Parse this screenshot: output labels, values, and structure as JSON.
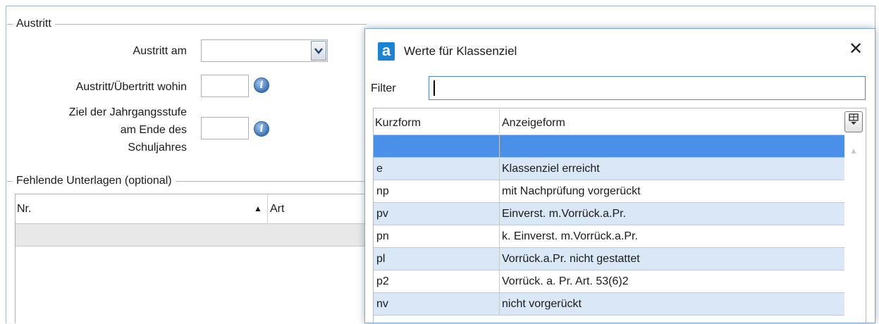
{
  "form": {
    "austritt_group_title": "Austritt",
    "austritt_am_label": "Austritt am",
    "austritt_am_value": "",
    "wohin_label": "Austritt/Übertritt wohin",
    "wohin_value": "",
    "ziel_label_line1": "Ziel der Jahrgangsstufe",
    "ziel_label_line2": "am Ende des",
    "ziel_label_line3": "Schuljahres",
    "ziel_value": "",
    "fehlende_group_title": "Fehlende Unterlagen (optional)",
    "table_col_nr": "Nr.",
    "table_col_art": "Art",
    "sort_indicator": "▲"
  },
  "dialog": {
    "app_icon_letter": "a",
    "title": "Werte für Klassenziel",
    "close_glyph": "✕",
    "filter_label": "Filter",
    "filter_value": "",
    "col_kurzform": "Kurzform",
    "col_anzeigeform": "Anzeigeform",
    "rows": [
      {
        "k": "",
        "a": ""
      },
      {
        "k": "e",
        "a": "Klassenziel erreicht"
      },
      {
        "k": "np",
        "a": "mit Nachprüfung vorgerückt"
      },
      {
        "k": "pv",
        "a": "Einverst. m.Vorrück.a.Pr."
      },
      {
        "k": "pn",
        "a": "k. Einverst. m.Vorrück.a.Pr."
      },
      {
        "k": "pl",
        "a": "Vorrück.a.Pr. nicht gestattet"
      },
      {
        "k": "p2",
        "a": "Vorrück. a. Pr. Art. 53(6)2"
      },
      {
        "k": "nv",
        "a": "nicht vorgerückt"
      }
    ]
  },
  "colors": {
    "selection": "#4a90e8",
    "alt_row": "#d9e7f7",
    "app_icon": "#1a83d6"
  }
}
